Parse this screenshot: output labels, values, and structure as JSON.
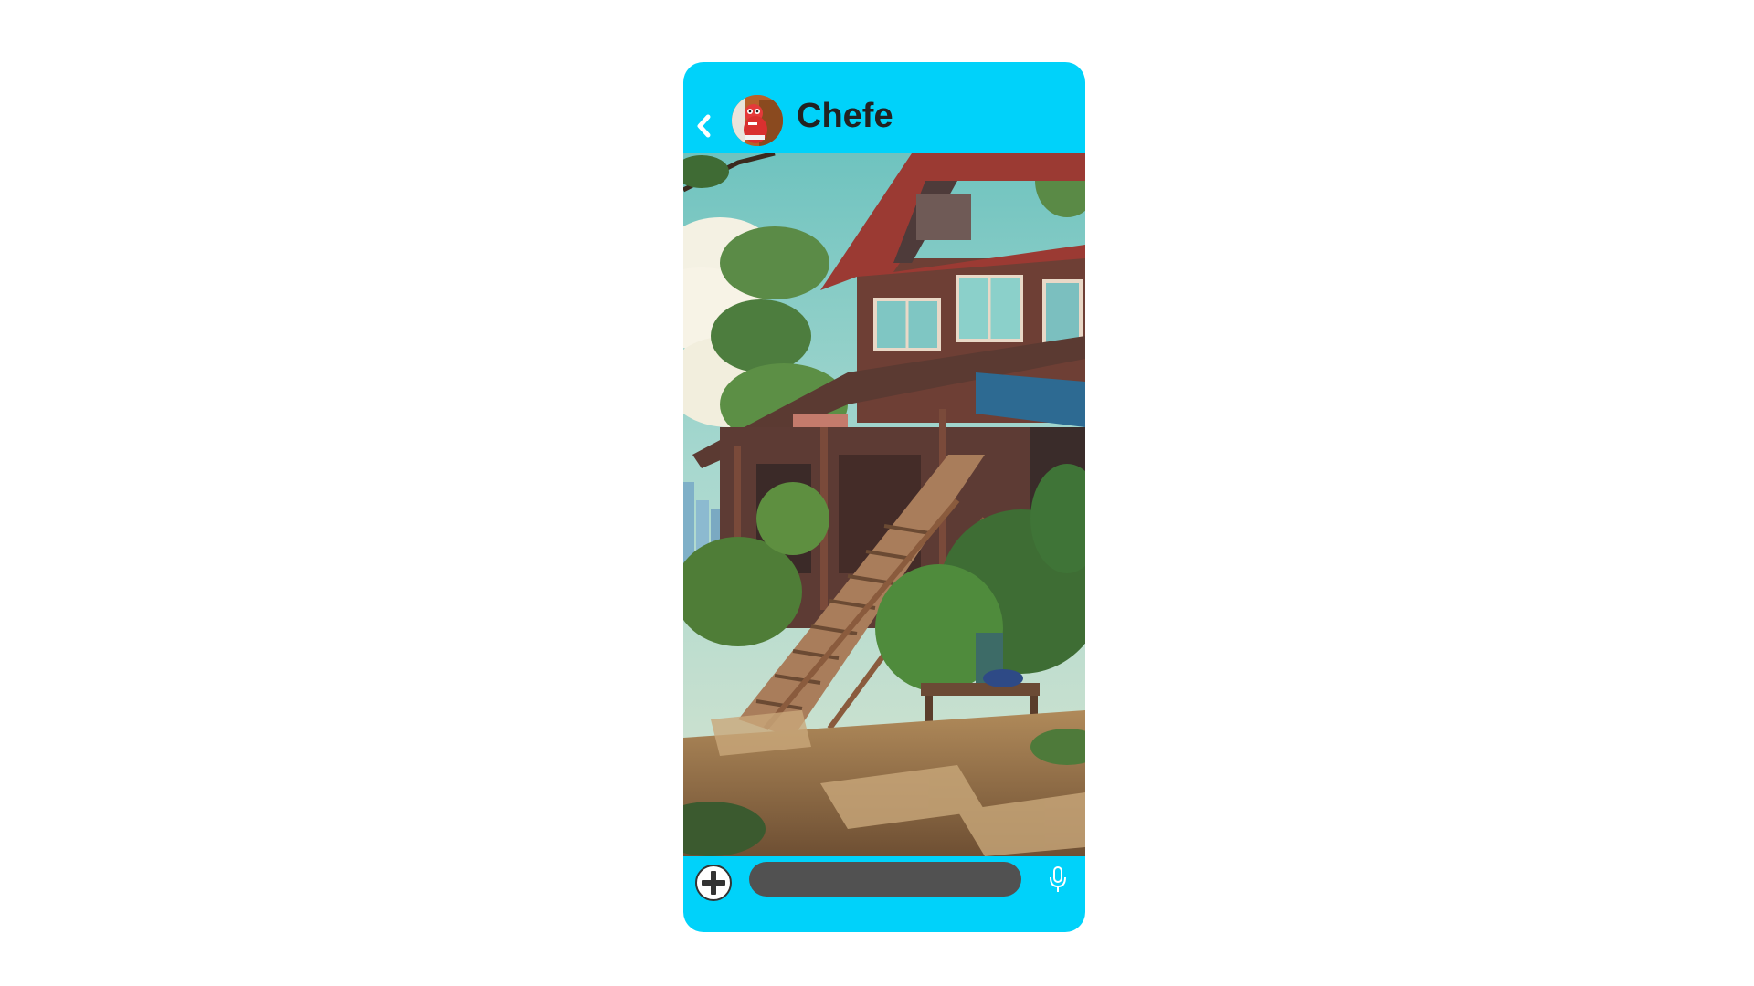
{
  "chat": {
    "contact_name": "Chefe"
  },
  "header": {
    "back_icon": "chevron-left-icon",
    "avatar_icon": "avatar"
  },
  "message": {
    "attachment": "image"
  },
  "composer": {
    "placeholder": "",
    "value": "",
    "add_icon": "plus-circle-icon",
    "mic_icon": "microphone-icon"
  },
  "colors": {
    "accent": "#00d2fa",
    "input_background": "#515151",
    "title_text": "#222222"
  }
}
